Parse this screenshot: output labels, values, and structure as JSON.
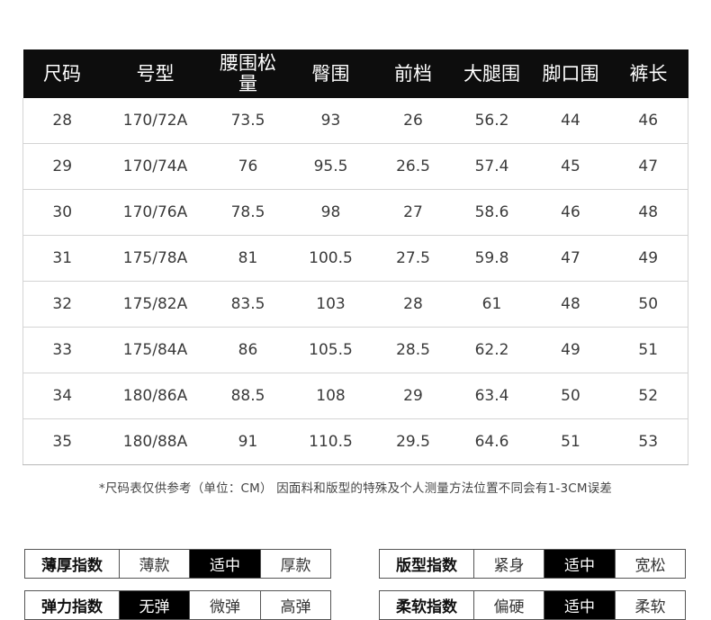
{
  "table": {
    "headers": [
      "尺码",
      "号型",
      "腰围松量",
      "臀围",
      "前档",
      "大腿围",
      "脚口围",
      "裤长"
    ],
    "rows": [
      [
        "28",
        "170/72A",
        "73.5",
        "93",
        "26",
        "56.2",
        "44",
        "46"
      ],
      [
        "29",
        "170/74A",
        "76",
        "95.5",
        "26.5",
        "57.4",
        "45",
        "47"
      ],
      [
        "30",
        "170/76A",
        "78.5",
        "98",
        "27",
        "58.6",
        "46",
        "48"
      ],
      [
        "31",
        "175/78A",
        "81",
        "100.5",
        "27.5",
        "59.8",
        "47",
        "49"
      ],
      [
        "32",
        "175/82A",
        "83.5",
        "103",
        "28",
        "61",
        "48",
        "50"
      ],
      [
        "33",
        "175/84A",
        "86",
        "105.5",
        "28.5",
        "62.2",
        "49",
        "51"
      ],
      [
        "34",
        "180/86A",
        "88.5",
        "108",
        "29",
        "63.4",
        "50",
        "52"
      ],
      [
        "35",
        "180/88A",
        "91",
        "110.5",
        "29.5",
        "64.6",
        "51",
        "53"
      ]
    ]
  },
  "note": "*尺码表仅供参考（单位：CM） 因面料和版型的特殊及个人测量方法位置不同会有1-3CM误差",
  "attributes": {
    "thickness": {
      "label": "薄厚指数",
      "options": [
        "薄款",
        "适中",
        "厚款"
      ],
      "selected": 1
    },
    "fit": {
      "label": "版型指数",
      "options": [
        "紧身",
        "适中",
        "宽松"
      ],
      "selected": 1
    },
    "stretch": {
      "label": "弹力指数",
      "options": [
        "无弹",
        "微弹",
        "高弹"
      ],
      "selected": 0
    },
    "softness": {
      "label": "柔软指数",
      "options": [
        "偏硬",
        "适中",
        "柔软"
      ],
      "selected": 1
    }
  },
  "colors": {
    "header_bg": "#0d0d0d",
    "selected_bg": "#000000",
    "border": "#d4d4d4"
  }
}
